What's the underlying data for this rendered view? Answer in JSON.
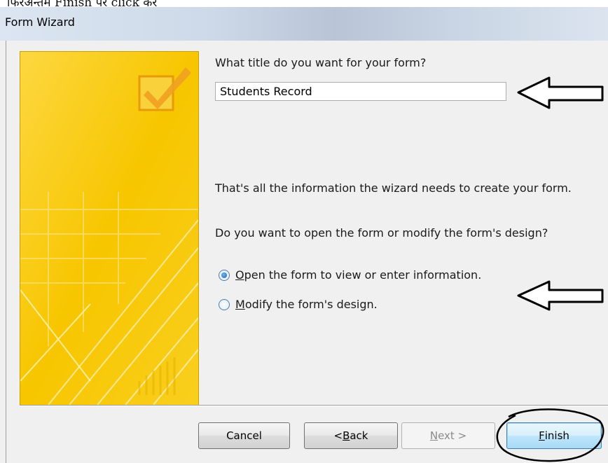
{
  "caption_fragment": "फिरअन्तमें Finish पर click करे",
  "window": {
    "title": "Form Wizard"
  },
  "main": {
    "question": "What title do you want for your form?",
    "title_value": "Students Record",
    "info_text": "That's all the information the wizard needs to create your form.",
    "prompt": "Do you want to open the form or modify the form's design?",
    "options": [
      {
        "label_mnemonic": "O",
        "label_rest": "pen the form to view or enter information.",
        "selected": true
      },
      {
        "label_mnemonic": "M",
        "label_rest": "odify the form's design.",
        "selected": false
      }
    ]
  },
  "buttons": {
    "cancel": "Cancel",
    "back_prefix": "< ",
    "back_mnemonic": "B",
    "back_rest": "ack",
    "next_mnemonic": "N",
    "next_rest": "ext >",
    "finish_mnemonic": "F",
    "finish_rest": "inish"
  },
  "colors": {
    "accent_yellow": "#f7c600",
    "annotation_black": "#000000"
  },
  "icons": [
    "checkbox-check-icon",
    "left-arrow-annotation",
    "circle-annotation"
  ]
}
